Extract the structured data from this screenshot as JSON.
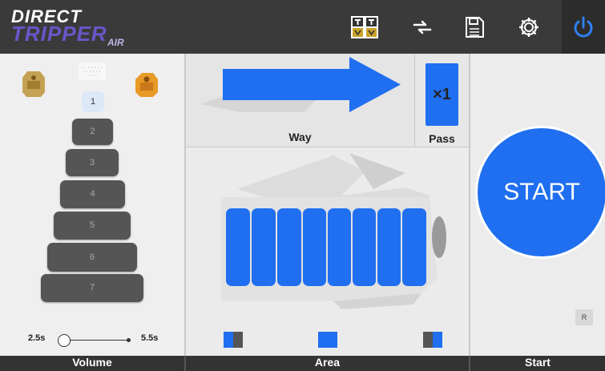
{
  "header": {
    "brand_line1": "DIRECT",
    "brand_line2": "TRIPPER",
    "brand_line3": "AIR",
    "icons": [
      "nozzle-set-icon",
      "sync-icon",
      "save-icon",
      "gear-icon",
      "power-icon"
    ]
  },
  "volume": {
    "rings": [
      "1",
      "2",
      "3",
      "4",
      "5",
      "6",
      "7"
    ],
    "selected_ring": "1",
    "slider_min_label": "2.5s",
    "slider_max_label": "5.5s",
    "slider_value_fraction": 0.0
  },
  "way": {
    "label": "Way"
  },
  "pass": {
    "value": "×1",
    "label": "Pass"
  },
  "area": {
    "label": "Area",
    "sections_count": 8
  },
  "start": {
    "button_label": "START",
    "reset_label": "R",
    "label": "Start"
  },
  "footer": {
    "volume": "Volume",
    "area": "Area",
    "start": "Start"
  },
  "colors": {
    "accent": "#1f6ff0",
    "topbar": "#3a3a3a",
    "brand": "#6b55c8"
  }
}
